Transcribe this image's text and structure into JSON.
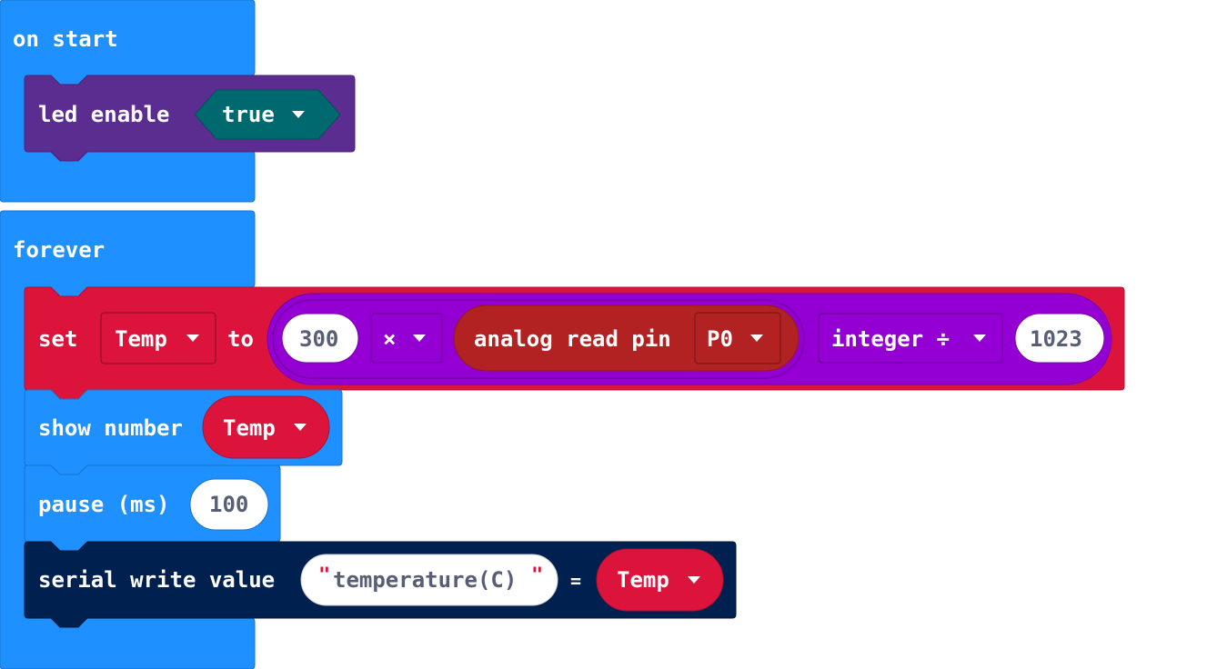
{
  "on_start": {
    "label": "on start",
    "led_enable": {
      "label": "led enable",
      "value": "true"
    }
  },
  "forever": {
    "label": "forever",
    "set": {
      "label": "set",
      "variable": "Temp",
      "to_label": "to",
      "left_number": "300",
      "op1": "×",
      "analog_read": {
        "label": "analog read pin",
        "pin": "P0"
      },
      "op2": "integer ÷",
      "right_number": "1023"
    },
    "show_number": {
      "label": "show number",
      "variable": "Temp"
    },
    "pause": {
      "label": "pause (ms)",
      "value": "100"
    },
    "serial_write": {
      "label": "serial write value",
      "name": "temperature(C)",
      "equals": "=",
      "variable": "Temp"
    }
  },
  "colors": {
    "basic_blue": "#1e90ff",
    "led_purple": "#5c2d91",
    "logic_teal": "#006970",
    "variables_red": "#dc143c",
    "math_purple": "#9400d3",
    "pins_darkred": "#b22222",
    "serial_navy": "#002050"
  }
}
